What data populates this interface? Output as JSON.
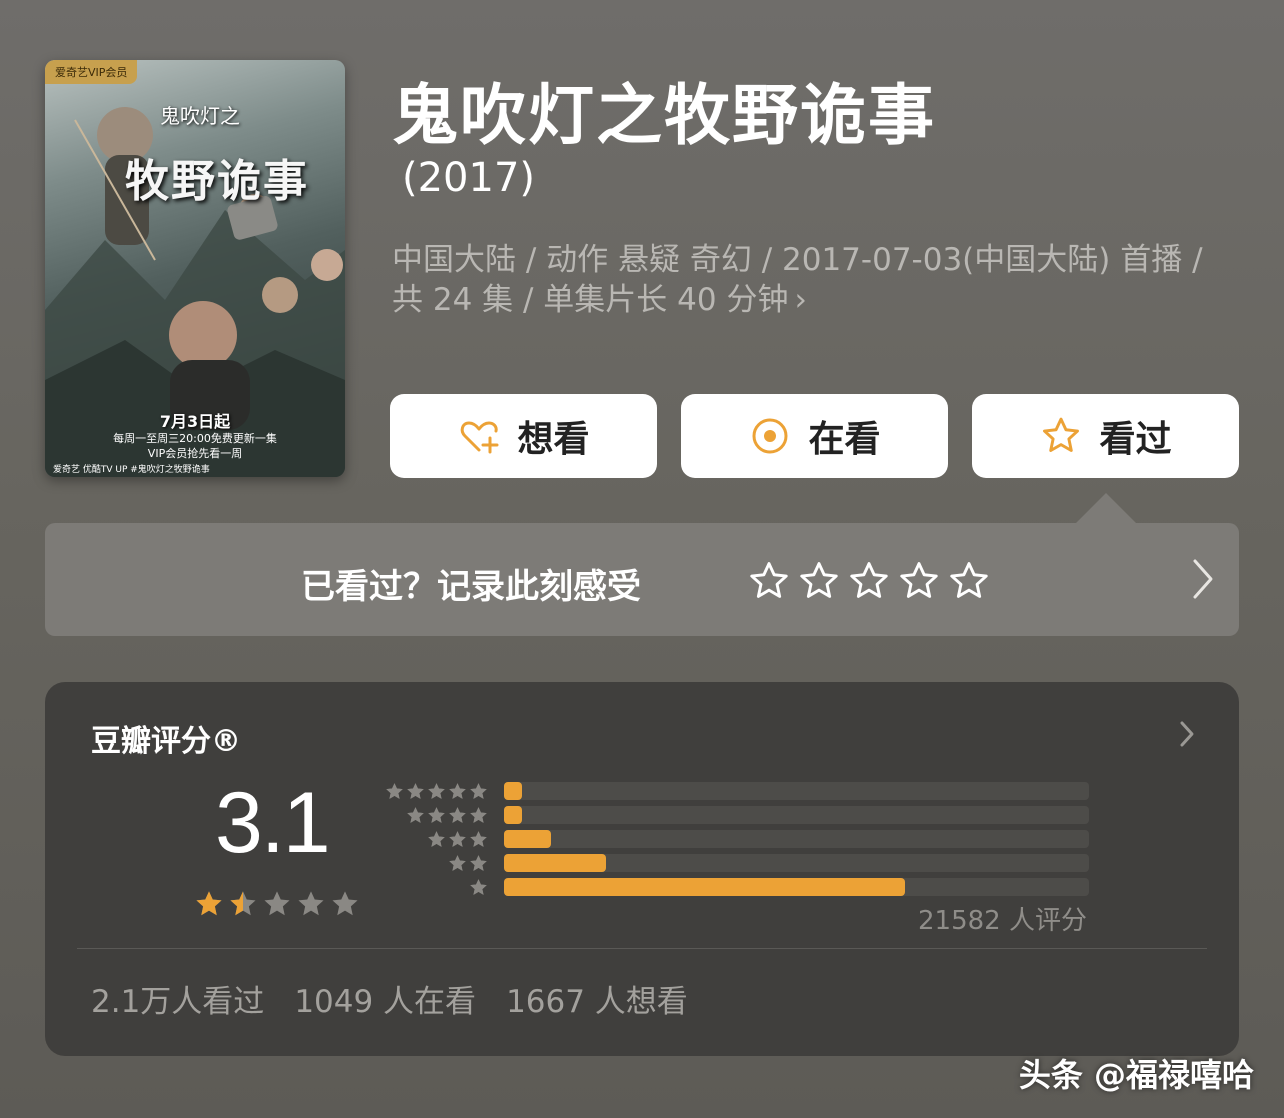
{
  "poster": {
    "vip_badge": "爱奇艺VIP会员",
    "small_title": "鬼吹灯之",
    "big_title": "牧野诡事",
    "date": "7月3日起",
    "line1": "每周一至周三20:00免费更新一集",
    "line2": "VIP会员抢先看一周",
    "footer": "爱奇艺  优酷TV  UP  #鬼吹灯之牧野诡事"
  },
  "title": "鬼吹灯之牧野诡事",
  "year": "(2017)",
  "meta": {
    "line": "中国大陆 / 动作 悬疑 奇幻 / 2017-07-03(中国大陆) 首播 / 共 24 集 / 单集片长 40 分钟",
    "chevron": "›"
  },
  "buttons": [
    {
      "label": "想看",
      "icon": "heart-plus-icon"
    },
    {
      "label": "在看",
      "icon": "target-circle-icon"
    },
    {
      "label": "看过",
      "icon": "star-outline-icon"
    }
  ],
  "rate_prompt": {
    "text": "已看过？记录此刻感受",
    "stars": 5,
    "chevron": "chevron-right-icon"
  },
  "rating": {
    "label": "豆瓣评分®",
    "score": "3.1",
    "star_value": 1.5,
    "distribution": [
      {
        "stars": 5,
        "fraction": 0.03
      },
      {
        "stars": 4,
        "fraction": 0.03
      },
      {
        "stars": 3,
        "fraction": 0.08
      },
      {
        "stars": 2,
        "fraction": 0.175
      },
      {
        "stars": 1,
        "fraction": 0.685
      }
    ],
    "raters": "21582 人评分",
    "stats": [
      "2.1万人看过",
      "1049 人在看",
      "1667 人想看"
    ]
  },
  "colors": {
    "accent": "#eca236",
    "panel": "#403f3d"
  },
  "watermark": "头条 @福禄嘻哈"
}
